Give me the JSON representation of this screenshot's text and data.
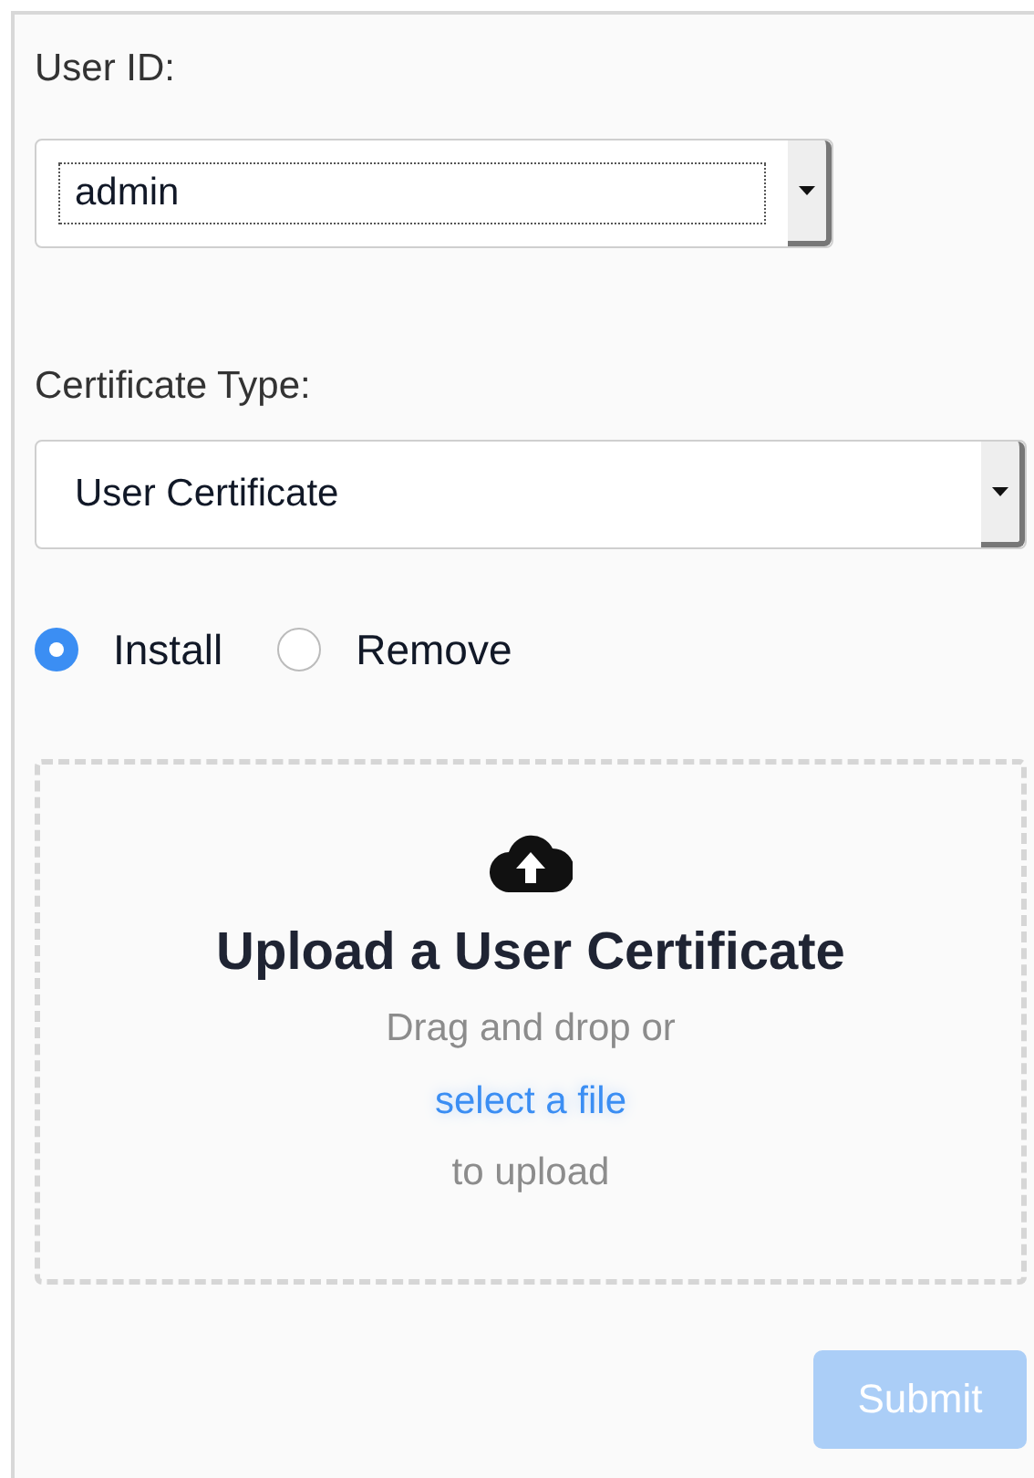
{
  "user_id": {
    "label": "User ID:",
    "value": "admin"
  },
  "certificate_type": {
    "label": "Certificate Type:",
    "value": "User Certificate"
  },
  "actions": [
    {
      "label": "Install",
      "selected": true
    },
    {
      "label": "Remove",
      "selected": false
    }
  ],
  "upload": {
    "title": "Upload a User Certificate",
    "line_1": "Drag and drop or",
    "link": "select a file",
    "line_2": "to upload"
  },
  "submit": {
    "label": "Submit",
    "disabled": true
  }
}
